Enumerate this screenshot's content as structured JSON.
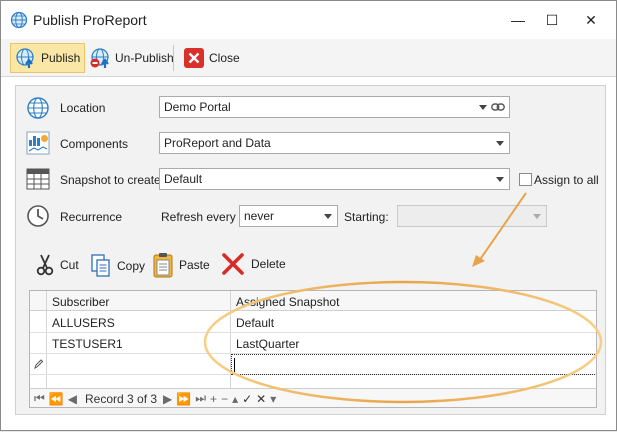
{
  "window": {
    "title": "Publish ProReport",
    "minimize_glyph": "—",
    "maximize_glyph": "☐",
    "close_glyph": "✕"
  },
  "toolbar": {
    "publish_label": "Publish",
    "unpublish_label": "Un-Publish",
    "close_label": "Close"
  },
  "form": {
    "location_label": "Location",
    "location_value": "Demo Portal",
    "components_label": "Components",
    "components_value": "ProReport and Data",
    "snapshot_label": "Snapshot to create",
    "snapshot_value": "Default",
    "assign_all_label": "Assign to all",
    "assign_all_checked": false,
    "recurrence_label": "Recurrence",
    "refresh_label": "Refresh every",
    "refresh_value": "never",
    "starting_label": "Starting:",
    "starting_value": ""
  },
  "actions": {
    "cut_label": "Cut",
    "copy_label": "Copy",
    "paste_label": "Paste",
    "delete_label": "Delete"
  },
  "grid": {
    "columns": [
      "Subscriber",
      "Assigned Snapshot"
    ],
    "rows": [
      {
        "subscriber": "ALLUSERS",
        "snapshot": "Default"
      },
      {
        "subscriber": "TESTUSER1",
        "snapshot": "LastQuarter"
      },
      {
        "subscriber": "",
        "snapshot": ""
      }
    ],
    "navigator": {
      "first": "⏮",
      "prev_page": "⏪",
      "prev": "◀",
      "record_text": "Record 3 of 3",
      "next": "▶",
      "next_page": "⏩",
      "last": "⏭",
      "add": "+",
      "remove": "−",
      "edit": "▴",
      "end_edit": "✓",
      "cancel": "✕",
      "refresh": "▾"
    }
  },
  "colors": {
    "active_button_bg": "#fbe7a5",
    "callout_stroke": "#e8a44a",
    "close_red": "#d9302c",
    "delete_red": "#d62b26"
  }
}
